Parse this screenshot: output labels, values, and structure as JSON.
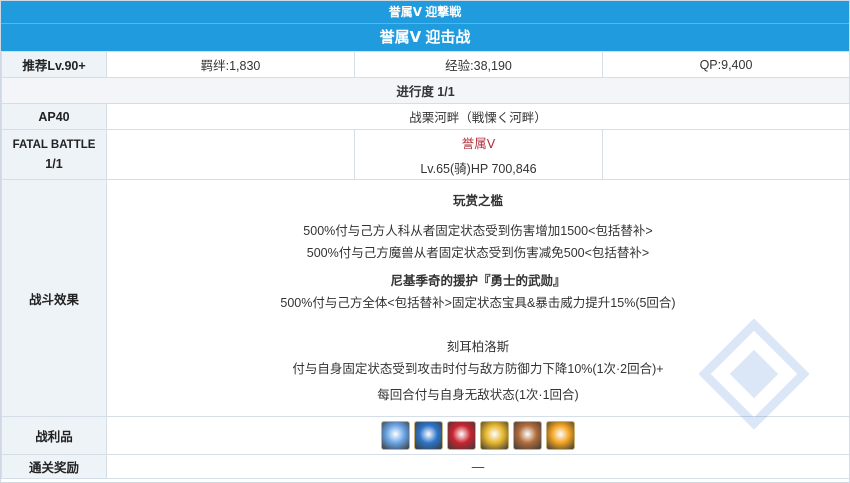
{
  "header": {
    "title_small": "誉属Ⅴ 迎撃戦",
    "title_main": "誉属Ⅴ 迎击战"
  },
  "stats": {
    "level_label": "推荐Lv.90+",
    "bond": "羁绊:1,830",
    "exp": "经验:38,190",
    "qp": "QP:9,400"
  },
  "progress": "进行度 1/1",
  "ap": {
    "label": "AP40",
    "location": "战栗河畔（戦慄く河畔）"
  },
  "battle": {
    "label_top": "FATAL BATTLE",
    "label_bottom": "1/1",
    "enemy_name": "誉属Ⅴ",
    "enemy_info": "Lv.65(骑)HP 700,846"
  },
  "effects": {
    "label": "战斗效果",
    "lines": [
      "玩赏之槛",
      "500%付与己方人科从者固定状态受到伤害增加1500<包括替补>",
      "500%付与己方魔兽从者固定状态受到伤害减免500<包括替补>",
      "尼基季奇的援护『勇士的武勋』",
      "500%付与己方全体<包括替补>固定状态宝具&暴击威力提升15%(5回合)",
      "刻耳柏洛斯",
      "付与自身固定状态受到攻击时付与敌方防御力下降10%(1次·2回合)+",
      "每回合付与自身无敌状态(1次·1回合)"
    ]
  },
  "loot": {
    "label": "战利品",
    "items": [
      "ice-crystal-icon",
      "blue-orb-icon",
      "red-gem-icon",
      "gold-star-icon",
      "wooden-toy-icon",
      "gold-fire-icon"
    ],
    "colors": [
      "#6aa5e6",
      "#2c74c9",
      "#c8232e",
      "#e6b52c",
      "#b06b3a",
      "#f0a21e"
    ]
  },
  "reward": {
    "label": "通关奖励",
    "value": "—"
  }
}
